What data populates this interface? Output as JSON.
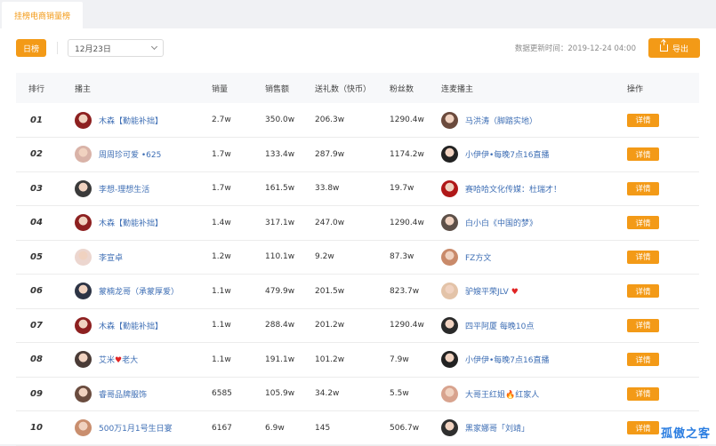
{
  "tab": {
    "label": "挂榜电商销量榜"
  },
  "toolbar": {
    "day_label": "日榜",
    "date_value": "12月23日",
    "update_text": "数据更新时间：2019-12-24 04:00",
    "export_label": "导出"
  },
  "table": {
    "headers": {
      "rank": "排行",
      "anchor": "播主",
      "sales": "销量",
      "revenue": "销售额",
      "gifts": "送礼数（快币）",
      "fans": "粉丝数",
      "linked": "连麦播主",
      "ops": "操作"
    },
    "detail_label": "详情",
    "rows": [
      {
        "rank": "01",
        "anchor": "木森【勤能补拙】",
        "sales": "2.7w",
        "revenue": "350.0w",
        "gifts": "206.3w",
        "fans": "1290.4w",
        "linked": "马洪涛（脚踏实地）",
        "a1": "#8d2020",
        "a2": "#6b4a3c"
      },
      {
        "rank": "02",
        "anchor": "周周珍可爱 •625",
        "sales": "1.7w",
        "revenue": "133.4w",
        "gifts": "287.9w",
        "fans": "1174.2w",
        "linked": "小伊伊•每晚7点16直播",
        "a1": "#d9b3a8",
        "a2": "#222222"
      },
      {
        "rank": "03",
        "anchor": "李想-理想生活",
        "sales": "1.7w",
        "revenue": "161.5w",
        "gifts": "33.8w",
        "fans": "19.7w",
        "linked": "赛哈哈文化传媒：杜瑞才！",
        "a1": "#3a3a3a",
        "a2": "#b01818"
      },
      {
        "rank": "04",
        "anchor": "木森【勤能补拙】",
        "sales": "1.4w",
        "revenue": "317.1w",
        "gifts": "247.0w",
        "fans": "1290.4w",
        "linked": "白小白《中国的梦》",
        "a1": "#8d2020",
        "a2": "#5d5048"
      },
      {
        "rank": "05",
        "anchor": "李宣卓",
        "sales": "1.2w",
        "revenue": "110.1w",
        "gifts": "9.2w",
        "fans": "87.3w",
        "linked": "FZ方文",
        "a1": "#ecd6cf",
        "a2": "#c98a6a"
      },
      {
        "rank": "06",
        "anchor": "蒙楠龙哥（承蒙厚爱）",
        "sales": "1.1w",
        "revenue": "479.9w",
        "gifts": "201.5w",
        "fans": "823.7w",
        "linked": "驴嫂平荣JLV",
        "linked_heart": true,
        "a1": "#2d3445",
        "a2": "#e3c3a8"
      },
      {
        "rank": "07",
        "anchor": "木森【勤能补拙】",
        "sales": "1.1w",
        "revenue": "288.4w",
        "gifts": "201.2w",
        "fans": "1290.4w",
        "linked": "四平阿厦 每晚10点",
        "a1": "#8d2020",
        "a2": "#2a2a2a"
      },
      {
        "rank": "08",
        "anchor": "艾米",
        "anchor_suffix": "老大",
        "anchor_heart": true,
        "sales": "1.1w",
        "revenue": "191.1w",
        "gifts": "101.2w",
        "fans": "7.9w",
        "linked": "小伊伊•每晚7点16直播",
        "a1": "#4a3b36",
        "a2": "#222222"
      },
      {
        "rank": "09",
        "anchor": "睿哥品牌服饰",
        "sales": "6585",
        "revenue": "105.9w",
        "gifts": "34.2w",
        "fans": "5.5w",
        "linked": "大哥王红姐",
        "linked_suffix": "红家人",
        "a1": "#6a4c3f",
        "a2": "#d8a38e"
      },
      {
        "rank": "10",
        "anchor": "500万1月1号生日宴",
        "sales": "6167",
        "revenue": "6.9w",
        "gifts": "145",
        "fans": "506.7w",
        "linked": "黑家娜哥「刘靖」",
        "a1": "#c98e6e",
        "a2": "#2f2f2f"
      }
    ]
  },
  "watermark": "孤傲之客"
}
